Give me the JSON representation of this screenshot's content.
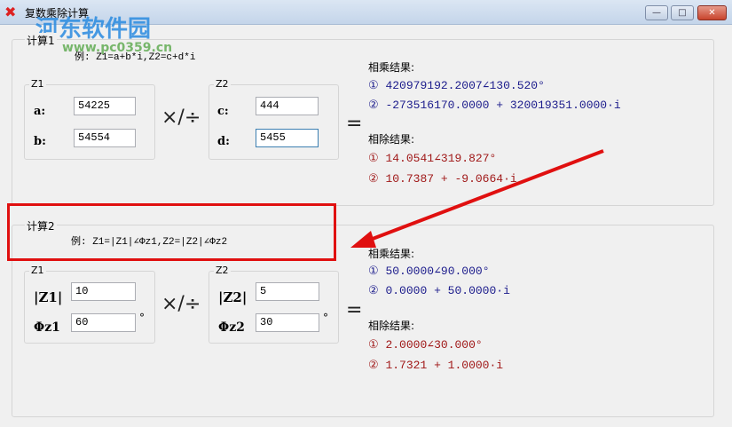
{
  "window": {
    "title": "复数乘除计算",
    "minimize": "—",
    "maximize": "□",
    "close": "✕"
  },
  "watermark": {
    "brand": "河东软件园",
    "url": "www.pc0359.cn"
  },
  "calc1": {
    "label": "计算1",
    "example": "例: Z1=a+b*i,Z2=c+d*i",
    "z1": {
      "label": "Z1",
      "a_label": "a:",
      "a": "54225",
      "b_label": "b:",
      "b": "54554"
    },
    "z2": {
      "label": "Z2",
      "c_label": "c:",
      "c": "444",
      "d_label": "d:",
      "d": "5455"
    },
    "operator": "×/÷",
    "equals": "=",
    "mul_title": "相乘结果:",
    "mul1": "① 420979192.2007∠130.520°",
    "mul2": "② -273516170.0000 + 320019351.0000·i",
    "div_title": "相除结果:",
    "div1": "① 14.0541∠319.827°",
    "div2": "② 10.7387 + -9.0664·i"
  },
  "calc2": {
    "label": "计算2",
    "example": "例: Z1=|Z1|∠Φz1,Z2=|Z2|∠Φz2",
    "z1": {
      "label": "Z1",
      "mag_label": "|Z1|",
      "mag": "10",
      "ang_label": "Φz1",
      "ang": "60",
      "deg": "°"
    },
    "z2": {
      "label": "Z2",
      "mag_label": "|Z2|",
      "mag": "5",
      "ang_label": "Φz2",
      "ang": "30",
      "deg": "°"
    },
    "operator": "×/÷",
    "equals": "=",
    "mul_title": "相乘结果:",
    "mul1": "① 50.0000∠90.000°",
    "mul2": "② 0.0000 + 50.0000·i",
    "div_title": "相除结果:",
    "div1": "① 2.0000∠30.000°",
    "div2": "② 1.7321 + 1.0000·i"
  },
  "annotation": {
    "color": "#e01010"
  }
}
